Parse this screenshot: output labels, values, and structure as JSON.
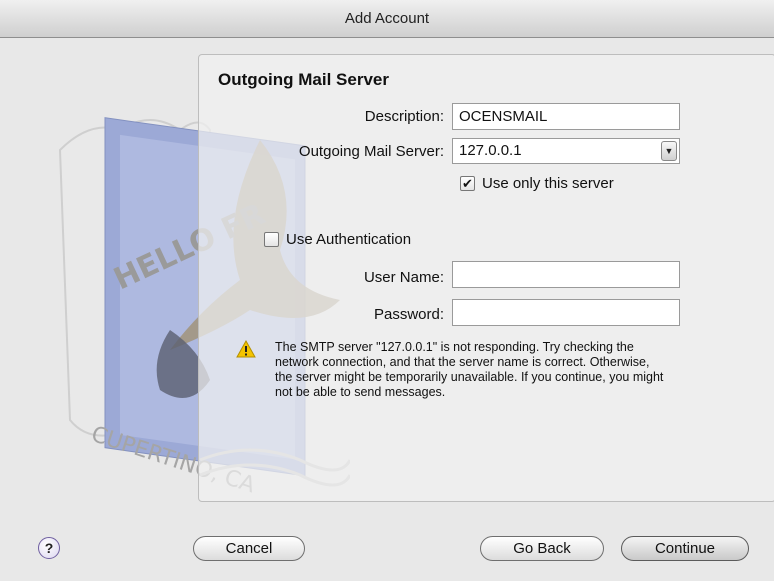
{
  "window": {
    "title": "Add Account"
  },
  "section": {
    "title": "Outgoing Mail Server"
  },
  "form": {
    "description_label": "Description:",
    "description_value": "OCENSMAIL",
    "server_label": "Outgoing Mail Server:",
    "server_value": "127.0.0.1",
    "use_only_label": "Use only this server",
    "use_only_checked": true,
    "use_auth_label": "Use Authentication",
    "use_auth_checked": false,
    "username_label": "User Name:",
    "username_value": "",
    "password_label": "Password:",
    "password_value": ""
  },
  "warning": {
    "icon": "warning-triangle-icon",
    "text": "The SMTP server \"127.0.0.1\" is not responding. Try checking the network connection, and that the server name is correct. Otherwise, the server might be temporarily unavailable. If you continue, you might not be able to send messages."
  },
  "buttons": {
    "help": "?",
    "cancel": "Cancel",
    "go_back": "Go Back",
    "continue": "Continue"
  },
  "stamp": {
    "icon": "mail-stamp-icon",
    "postmark_text": "HELLO FR",
    "postmark_city": "CUPERTINO, CA"
  },
  "icons": {
    "dropdown": "chevron-down-icon",
    "check": "checkmark-icon"
  }
}
